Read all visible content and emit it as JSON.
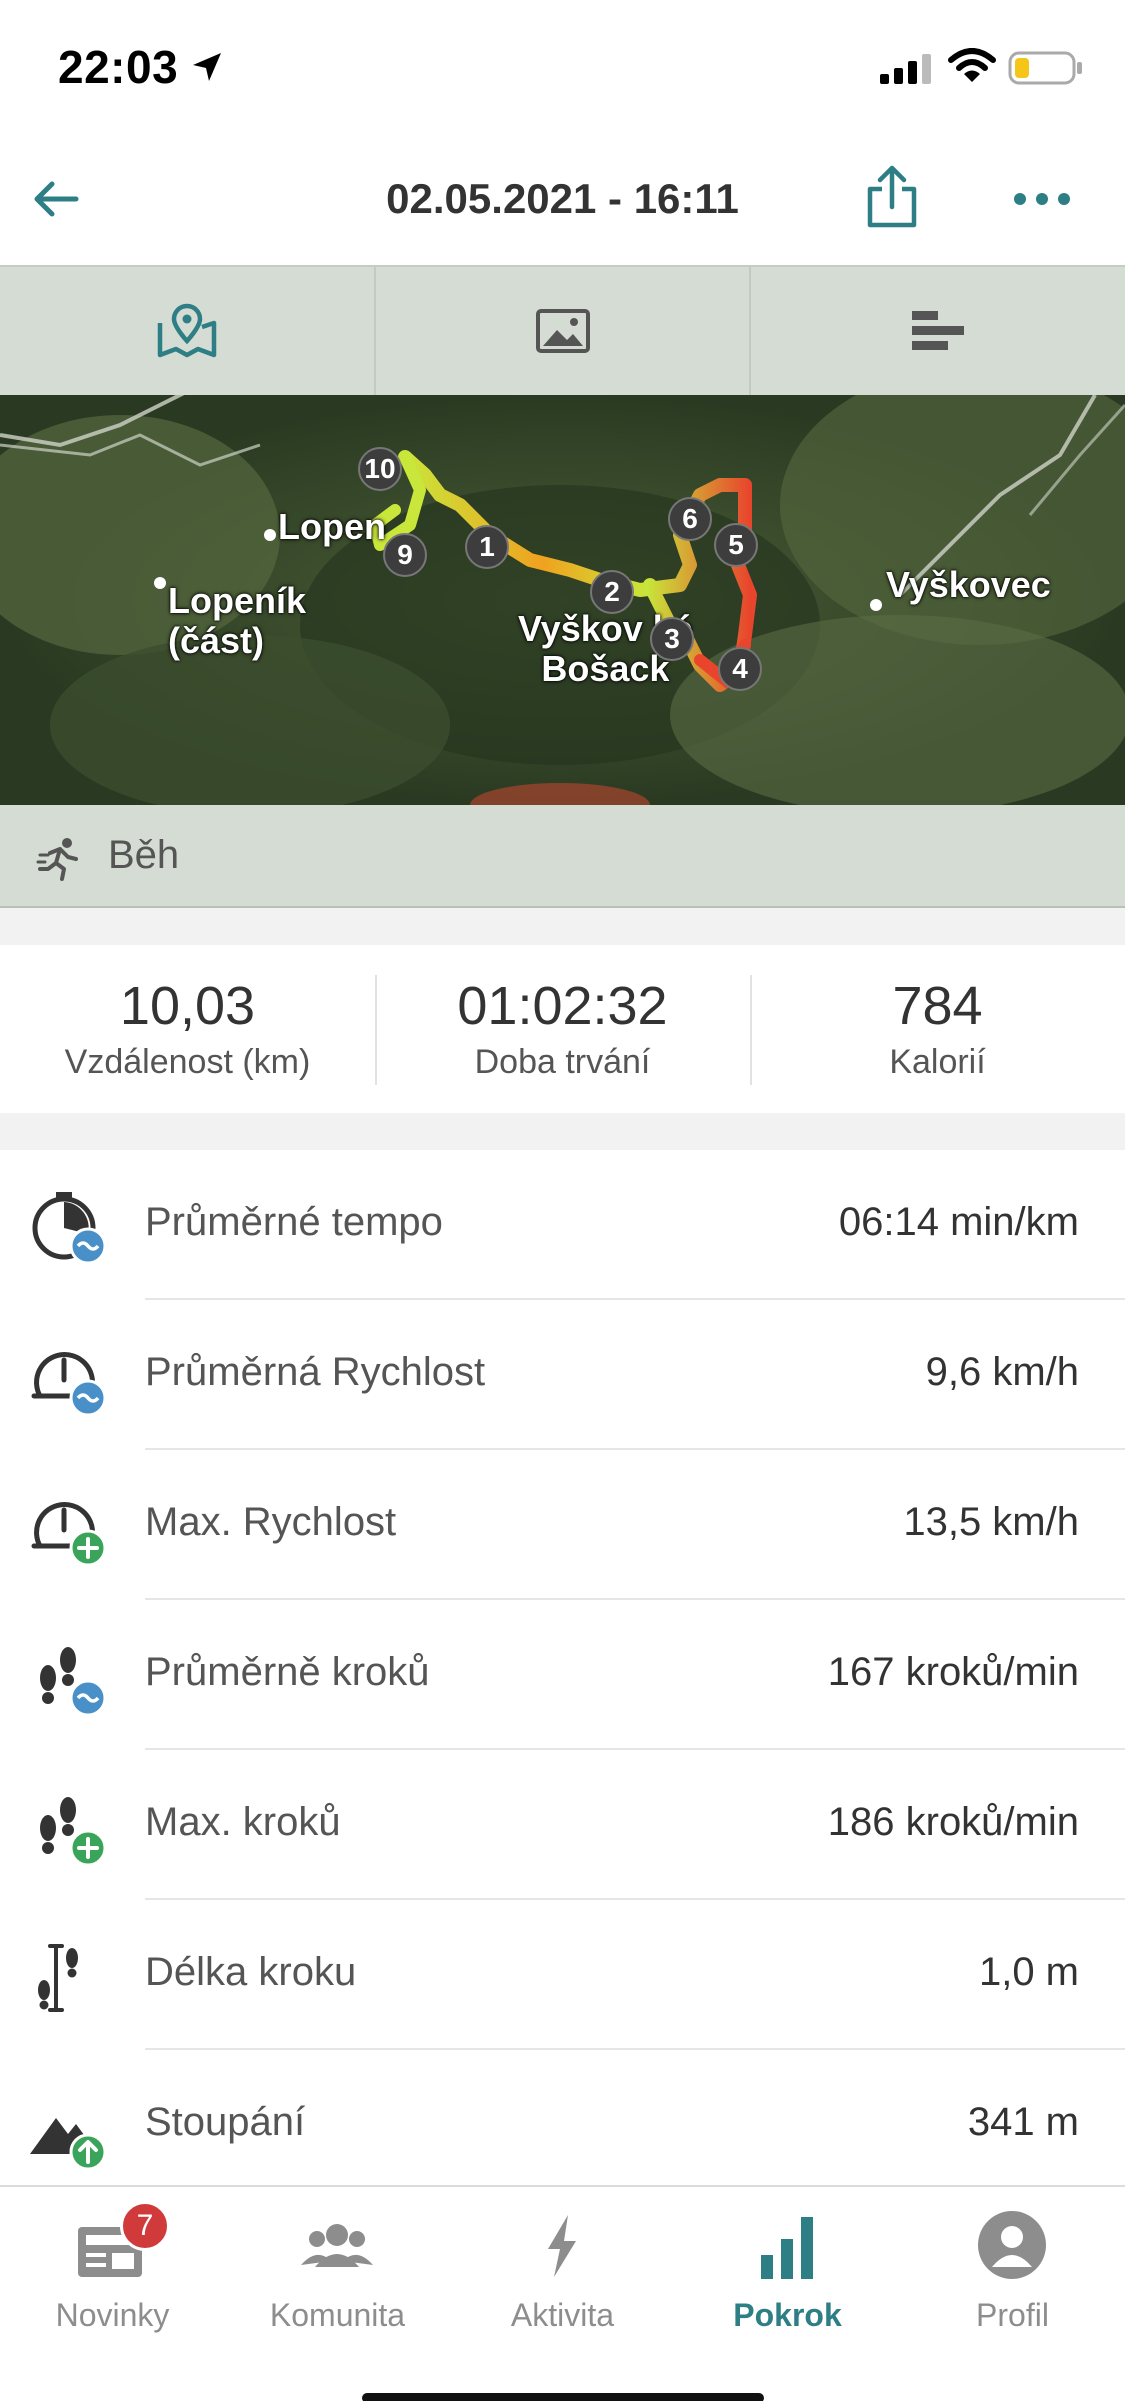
{
  "status_bar": {
    "time": "22:03",
    "icons": [
      "location-arrow-icon",
      "signal-icon",
      "wifi-icon",
      "battery-low-icon"
    ]
  },
  "header": {
    "title": "02.05.2021 - 16:11",
    "back_icon": "arrow-left-icon",
    "share_icon": "share-icon",
    "more_icon": "more-dots-icon"
  },
  "view_tabs": [
    {
      "name": "map",
      "icon": "map-icon",
      "active": true
    },
    {
      "name": "photos",
      "icon": "image-icon",
      "active": false
    },
    {
      "name": "stats",
      "icon": "bar-list-icon",
      "active": false
    }
  ],
  "map": {
    "places": [
      "Lopen",
      "Lopeník\n(část)",
      "Vyškov ké\nBošack",
      "Vyškovec"
    ],
    "markers": [
      "1",
      "2",
      "3",
      "4",
      "5",
      "6",
      "9",
      "10"
    ]
  },
  "activity": {
    "label": "Běh",
    "icon": "running-icon"
  },
  "summary": [
    {
      "value": "10,03",
      "label": "Vzdálenost (km)"
    },
    {
      "value": "01:02:32",
      "label": "Doba trvání"
    },
    {
      "value": "784",
      "label": "Kalorií"
    }
  ],
  "stats": [
    {
      "label": "Průměrné tempo",
      "value": "06:14 min/km",
      "icon": "stopwatch-average-icon"
    },
    {
      "label": "Průměrná Rychlost",
      "value": "9,6 km/h",
      "icon": "speedometer-average-icon"
    },
    {
      "label": "Max. Rychlost",
      "value": "13,5 km/h",
      "icon": "speedometer-max-icon"
    },
    {
      "label": "Průměrně kroků",
      "value": "167 kroků/min",
      "icon": "footsteps-average-icon"
    },
    {
      "label": "Max. kroků",
      "value": "186 kroků/min",
      "icon": "footsteps-max-icon"
    },
    {
      "label": "Délka kroku",
      "value": "1,0 m",
      "icon": "stride-length-icon"
    },
    {
      "label": "Stoupání",
      "value": "341 m",
      "icon": "mountain-ascent-icon"
    }
  ],
  "tabbar": {
    "items": [
      {
        "label": "Novinky",
        "icon": "news-icon",
        "badge": "7"
      },
      {
        "label": "Komunita",
        "icon": "community-icon"
      },
      {
        "label": "Aktivita",
        "icon": "lightning-icon"
      },
      {
        "label": "Pokrok",
        "icon": "progress-chart-icon",
        "active": true
      },
      {
        "label": "Profil",
        "icon": "profile-icon"
      }
    ]
  },
  "colors": {
    "accent": "#2d7f85",
    "badge": "#d13a3a",
    "tab_bar_bg": "#d5dcd3",
    "route_start": "#c9e63a",
    "route_mid": "#f0a21f",
    "route_high": "#e8452c"
  }
}
